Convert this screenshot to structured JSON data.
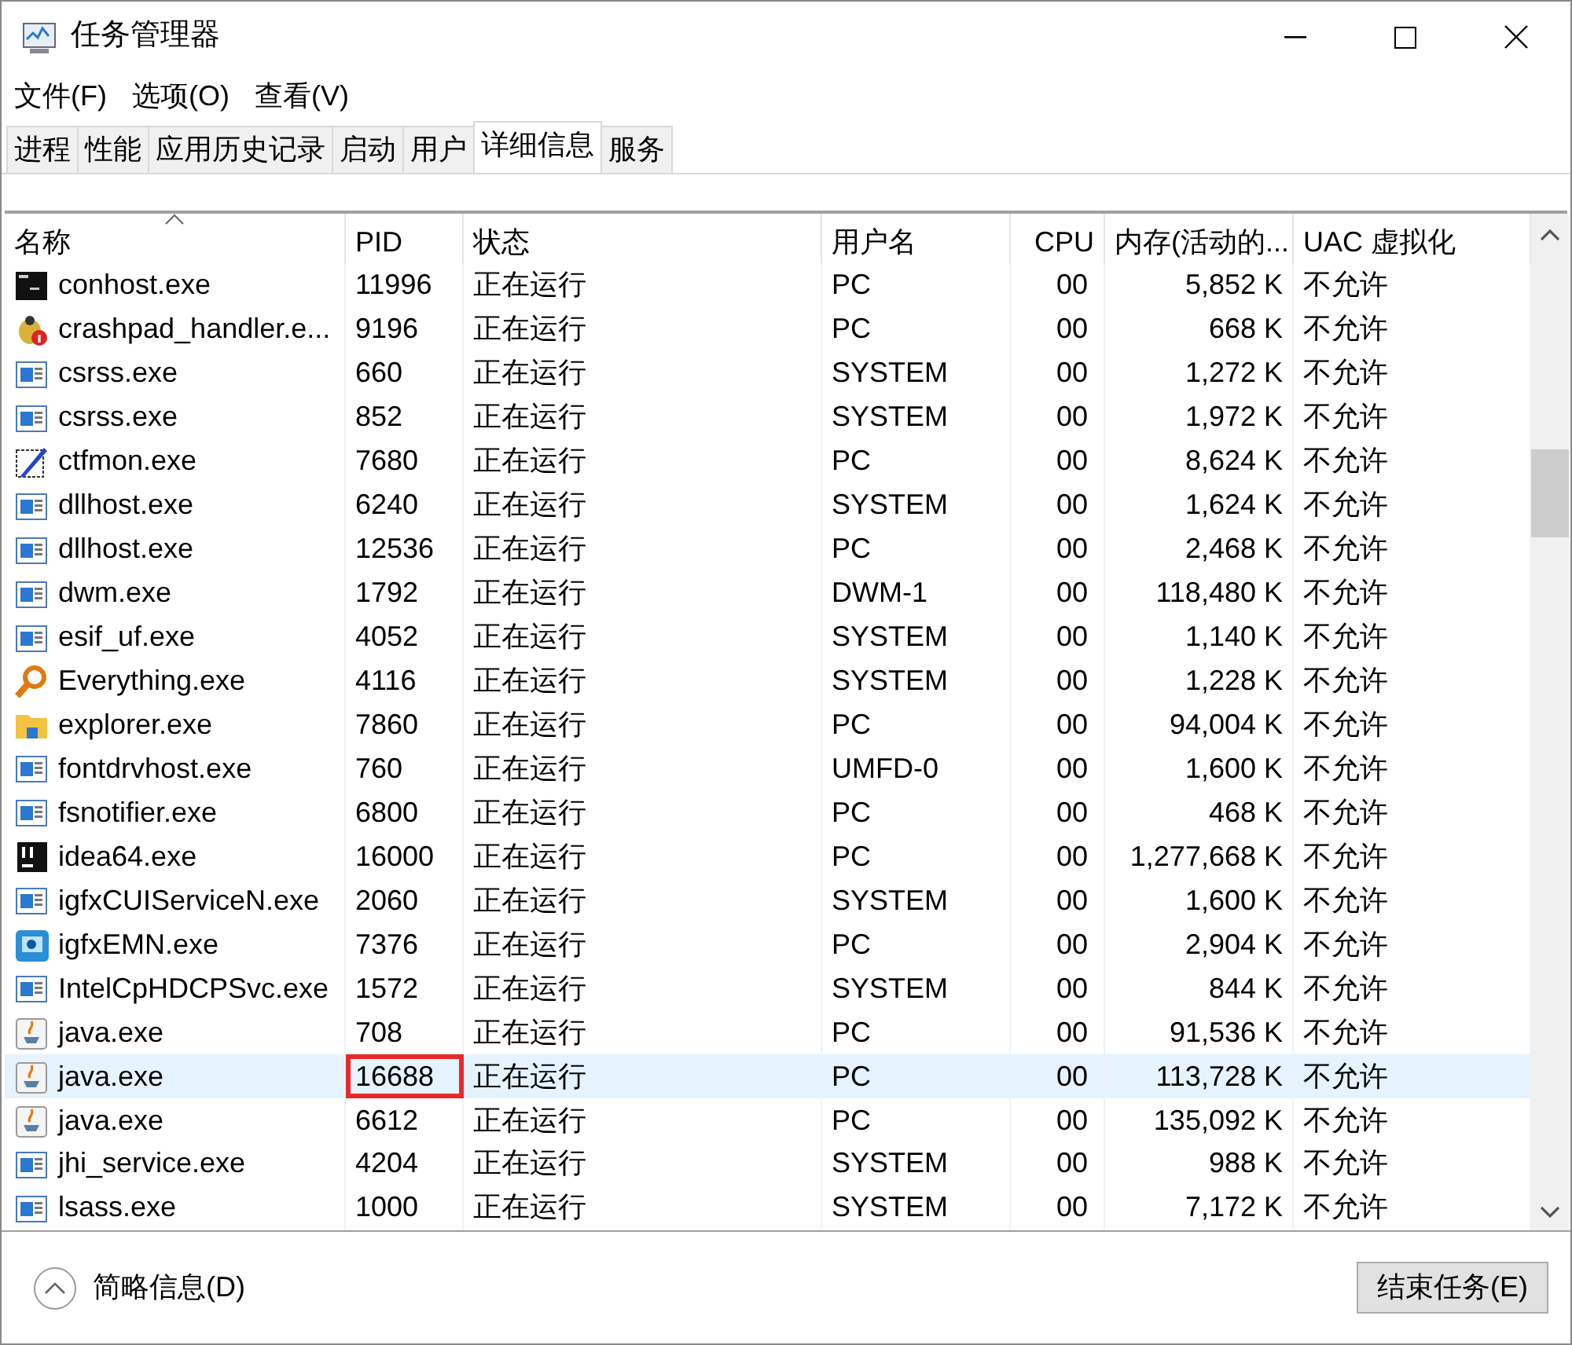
{
  "window": {
    "title": "任务管理器"
  },
  "menu": [
    "文件(F)",
    "选项(O)",
    "查看(V)"
  ],
  "tabs": [
    {
      "label": "进程",
      "selected": false
    },
    {
      "label": "性能",
      "selected": false
    },
    {
      "label": "应用历史记录",
      "selected": false
    },
    {
      "label": "启动",
      "selected": false
    },
    {
      "label": "用户",
      "selected": false
    },
    {
      "label": "详细信息",
      "selected": true
    },
    {
      "label": "服务",
      "selected": false
    }
  ],
  "table": {
    "columns": [
      {
        "label": "名称",
        "sorted": true
      },
      {
        "label": "PID",
        "sorted": false
      },
      {
        "label": "状态",
        "sorted": false
      },
      {
        "label": "用户名",
        "sorted": false
      },
      {
        "label": "CPU",
        "sorted": false
      },
      {
        "label": "内存(活动的...",
        "sorted": false
      },
      {
        "label": "UAC 虚拟化",
        "sorted": false
      }
    ],
    "rows": [
      {
        "kind": "console",
        "name": "conhost.exe",
        "pid": "11996",
        "status": "正在运行",
        "user": "PC",
        "cpu": "00",
        "memory": "5,852 K",
        "uac": "不允许",
        "selected": false,
        "pid_marked": false
      },
      {
        "kind": "bug",
        "name": "crashpad_handler.e...",
        "pid": "9196",
        "status": "正在运行",
        "user": "PC",
        "cpu": "00",
        "memory": "668 K",
        "uac": "不允许",
        "selected": false,
        "pid_marked": false
      },
      {
        "kind": "window",
        "name": "csrss.exe",
        "pid": "660",
        "status": "正在运行",
        "user": "SYSTEM",
        "cpu": "00",
        "memory": "1,272 K",
        "uac": "不允许",
        "selected": false,
        "pid_marked": false
      },
      {
        "kind": "window",
        "name": "csrss.exe",
        "pid": "852",
        "status": "正在运行",
        "user": "SYSTEM",
        "cpu": "00",
        "memory": "1,972 K",
        "uac": "不允许",
        "selected": false,
        "pid_marked": false
      },
      {
        "kind": "pen",
        "name": "ctfmon.exe",
        "pid": "7680",
        "status": "正在运行",
        "user": "PC",
        "cpu": "00",
        "memory": "8,624 K",
        "uac": "不允许",
        "selected": false,
        "pid_marked": false
      },
      {
        "kind": "window",
        "name": "dllhost.exe",
        "pid": "6240",
        "status": "正在运行",
        "user": "SYSTEM",
        "cpu": "00",
        "memory": "1,624 K",
        "uac": "不允许",
        "selected": false,
        "pid_marked": false
      },
      {
        "kind": "window",
        "name": "dllhost.exe",
        "pid": "12536",
        "status": "正在运行",
        "user": "PC",
        "cpu": "00",
        "memory": "2,468 K",
        "uac": "不允许",
        "selected": false,
        "pid_marked": false
      },
      {
        "kind": "window",
        "name": "dwm.exe",
        "pid": "1792",
        "status": "正在运行",
        "user": "DWM-1",
        "cpu": "00",
        "memory": "118,480 K",
        "uac": "不允许",
        "selected": false,
        "pid_marked": false
      },
      {
        "kind": "window",
        "name": "esif_uf.exe",
        "pid": "4052",
        "status": "正在运行",
        "user": "SYSTEM",
        "cpu": "00",
        "memory": "1,140 K",
        "uac": "不允许",
        "selected": false,
        "pid_marked": false
      },
      {
        "kind": "magnifier",
        "name": "Everything.exe",
        "pid": "4116",
        "status": "正在运行",
        "user": "SYSTEM",
        "cpu": "00",
        "memory": "1,228 K",
        "uac": "不允许",
        "selected": false,
        "pid_marked": false
      },
      {
        "kind": "folder",
        "name": "explorer.exe",
        "pid": "7860",
        "status": "正在运行",
        "user": "PC",
        "cpu": "00",
        "memory": "94,004 K",
        "uac": "不允许",
        "selected": false,
        "pid_marked": false
      },
      {
        "kind": "window",
        "name": "fontdrvhost.exe",
        "pid": "760",
        "status": "正在运行",
        "user": "UMFD-0",
        "cpu": "00",
        "memory": "1,600 K",
        "uac": "不允许",
        "selected": false,
        "pid_marked": false
      },
      {
        "kind": "window",
        "name": "fsnotifier.exe",
        "pid": "6800",
        "status": "正在运行",
        "user": "PC",
        "cpu": "00",
        "memory": "468 K",
        "uac": "不允许",
        "selected": false,
        "pid_marked": false
      },
      {
        "kind": "ide",
        "name": "idea64.exe",
        "pid": "16000",
        "status": "正在运行",
        "user": "PC",
        "cpu": "00",
        "memory": "1,277,668 K",
        "uac": "不允许",
        "selected": false,
        "pid_marked": false
      },
      {
        "kind": "window",
        "name": "igfxCUIServiceN.exe",
        "pid": "2060",
        "status": "正在运行",
        "user": "SYSTEM",
        "cpu": "00",
        "memory": "1,600 K",
        "uac": "不允许",
        "selected": false,
        "pid_marked": false
      },
      {
        "kind": "chip",
        "name": "igfxEMN.exe",
        "pid": "7376",
        "status": "正在运行",
        "user": "PC",
        "cpu": "00",
        "memory": "2,904 K",
        "uac": "不允许",
        "selected": false,
        "pid_marked": false
      },
      {
        "kind": "window",
        "name": "IntelCpHDCPSvc.exe",
        "pid": "1572",
        "status": "正在运行",
        "user": "SYSTEM",
        "cpu": "00",
        "memory": "844 K",
        "uac": "不允许",
        "selected": false,
        "pid_marked": false
      },
      {
        "kind": "cup",
        "name": "java.exe",
        "pid": "708",
        "status": "正在运行",
        "user": "PC",
        "cpu": "00",
        "memory": "91,536 K",
        "uac": "不允许",
        "selected": false,
        "pid_marked": false
      },
      {
        "kind": "cup",
        "name": "java.exe",
        "pid": "16688",
        "status": "正在运行",
        "user": "PC",
        "cpu": "00",
        "memory": "113,728 K",
        "uac": "不允许",
        "selected": true,
        "pid_marked": true
      },
      {
        "kind": "cup",
        "name": "java.exe",
        "pid": "6612",
        "status": "正在运行",
        "user": "PC",
        "cpu": "00",
        "memory": "135,092 K",
        "uac": "不允许",
        "selected": false,
        "pid_marked": false
      },
      {
        "kind": "window",
        "name": "jhi_service.exe",
        "pid": "4204",
        "status": "正在运行",
        "user": "SYSTEM",
        "cpu": "00",
        "memory": "988 K",
        "uac": "不允许",
        "selected": false,
        "pid_marked": false
      },
      {
        "kind": "window",
        "name": "lsass.exe",
        "pid": "1000",
        "status": "正在运行",
        "user": "SYSTEM",
        "cpu": "00",
        "memory": "7,172 K",
        "uac": "不允许",
        "selected": false,
        "pid_marked": false
      }
    ]
  },
  "footer": {
    "details_toggle": "简略信息(D)",
    "end_task_button": "结束任务(E)"
  }
}
